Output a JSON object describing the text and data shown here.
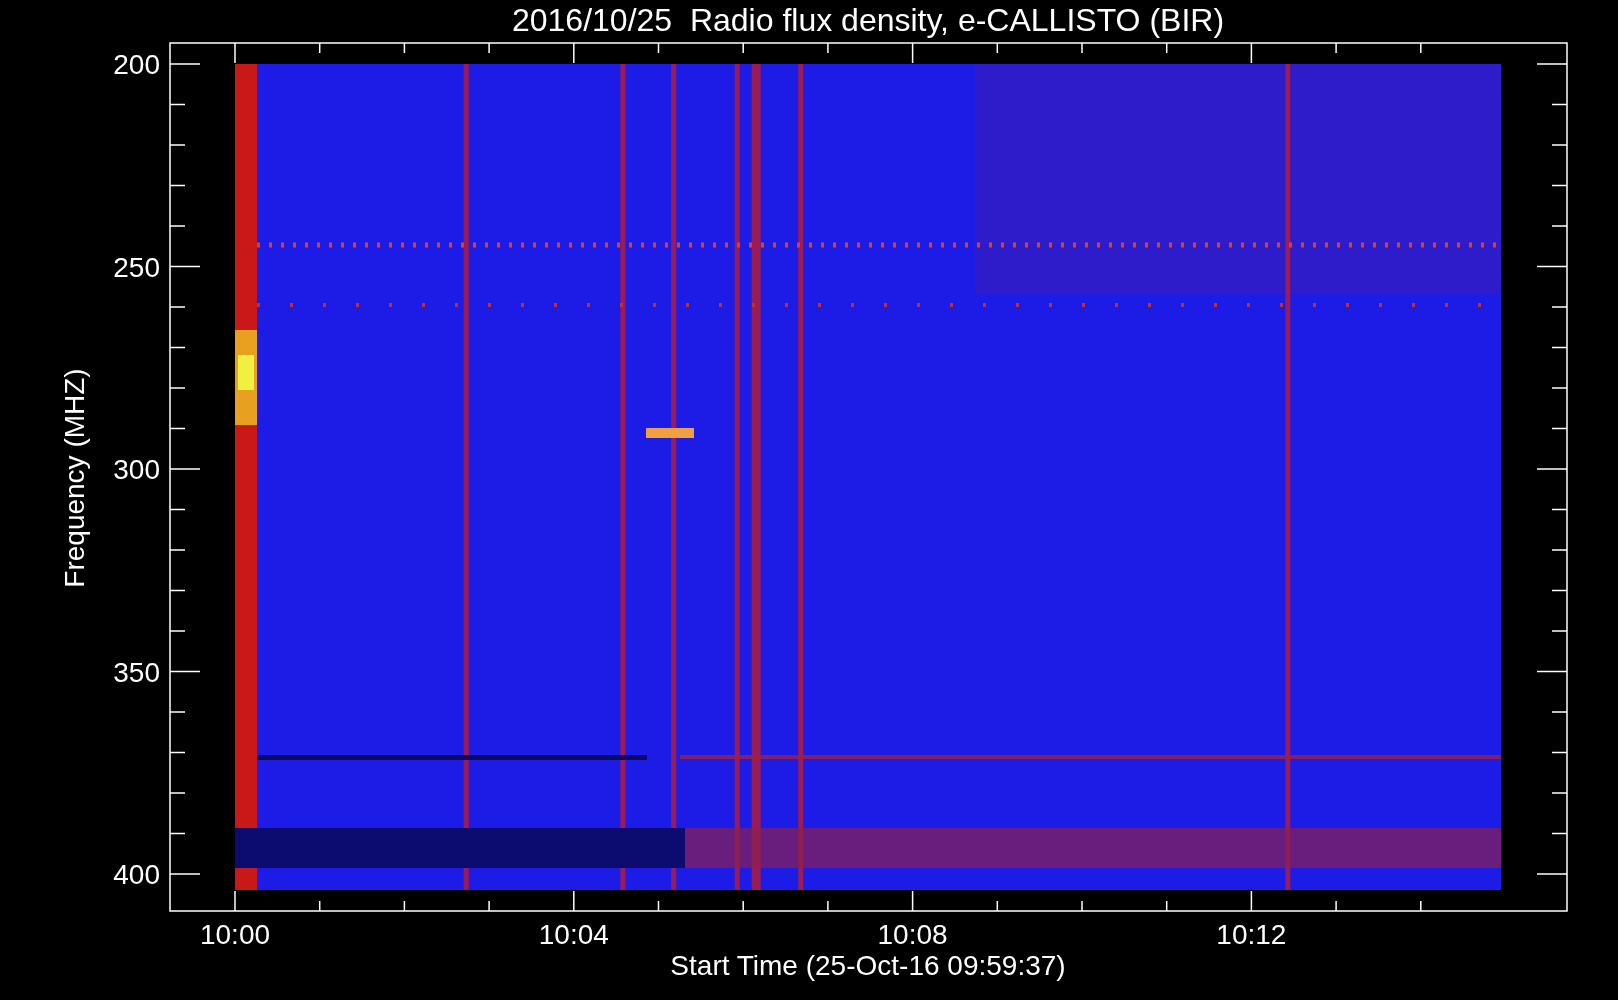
{
  "title": "2016/10/25  Radio flux density, e-CALLISTO (BIR)",
  "ylabel": "Frequency (MHZ)",
  "xlabel": "Start Time (25-Oct-16 09:59:37)",
  "yticks": [
    "200",
    "250",
    "300",
    "350",
    "400"
  ],
  "xticks": [
    "10:00",
    "10:04",
    "10:08",
    "10:12"
  ]
}
